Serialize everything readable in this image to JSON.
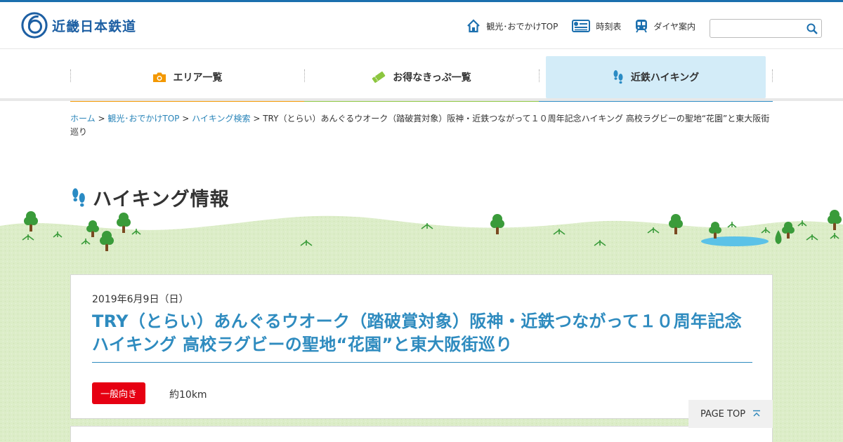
{
  "site": {
    "logo_text": "近畿日本鉄道"
  },
  "header_nav": [
    {
      "label": "観光･おでかけTOP",
      "icon": "house-icon"
    },
    {
      "label": "時刻表",
      "icon": "timetable-icon"
    },
    {
      "label": "ダイヤ案内",
      "icon": "train-icon"
    }
  ],
  "search": {
    "placeholder": "",
    "value": ""
  },
  "main_nav": [
    {
      "label": "エリア一覧",
      "icon": "camera-icon",
      "color": "#f39800"
    },
    {
      "label": "お得なきっぷ一覧",
      "icon": "ticket-icon",
      "color": "#8cc63f"
    },
    {
      "label": "近鉄ハイキング",
      "icon": "footprints-icon",
      "color": "#2a8bc4",
      "active": true
    }
  ],
  "breadcrumb": [
    {
      "label": "ホーム",
      "link": true
    },
    {
      "label": "観光･おでかけTOP",
      "link": true
    },
    {
      "label": "ハイキング検索",
      "link": true
    },
    {
      "label": "TRY（とらい）あんぐるウオーク（踏破賞対象）阪神・近鉄つながって１０周年記念ハイキング 高校ラグビーの聖地“花園”と東大阪街巡り",
      "link": false
    }
  ],
  "breadcrumb_separator": ">",
  "page_title": "ハイキング情報",
  "event": {
    "date": "2019年6月9日（日）",
    "title": "TRY（とらい）あんぐるウオーク（踏破賞対象）阪神・近鉄つながって１０周年記念ハイキング 高校ラグビーの聖地“花園”と東大阪街巡り",
    "level_badge": "一般向き",
    "distance": "約10km"
  },
  "page_top": {
    "label": "PAGE TOP"
  },
  "colors": {
    "brand": "#1d5fa3",
    "link": "#2a85b9",
    "title": "#2e8bbf",
    "badge": "#e60012",
    "grass": "#d9ecc4"
  }
}
